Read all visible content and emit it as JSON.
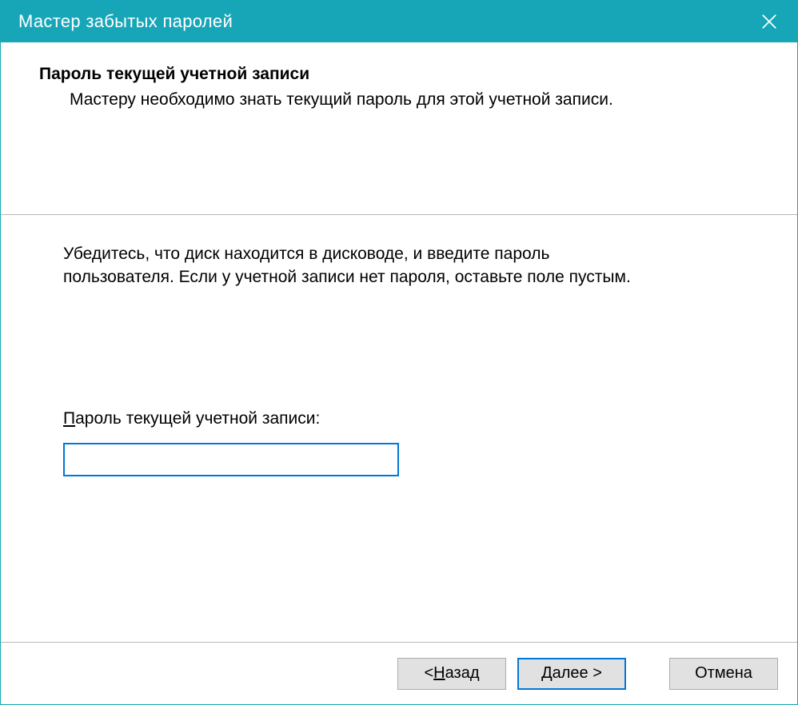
{
  "titlebar": {
    "title": "Мастер забытых паролей"
  },
  "header": {
    "title": "Пароль текущей учетной записи",
    "subtitle": "Мастеру необходимо знать текущий пароль для этой учетной записи."
  },
  "content": {
    "instruction": "Убедитесь, что диск находится в дисководе, и введите пароль пользователя. Если у учетной записи нет пароля, оставьте поле пустым.",
    "password_label_accel": "П",
    "password_label_rest": "ароль текущей учетной записи:",
    "password_value": ""
  },
  "footer": {
    "back_prefix": "< ",
    "back_accel": "Н",
    "back_rest": "азад",
    "next_accel": "Д",
    "next_rest": "алее >",
    "cancel": "Отмена"
  }
}
